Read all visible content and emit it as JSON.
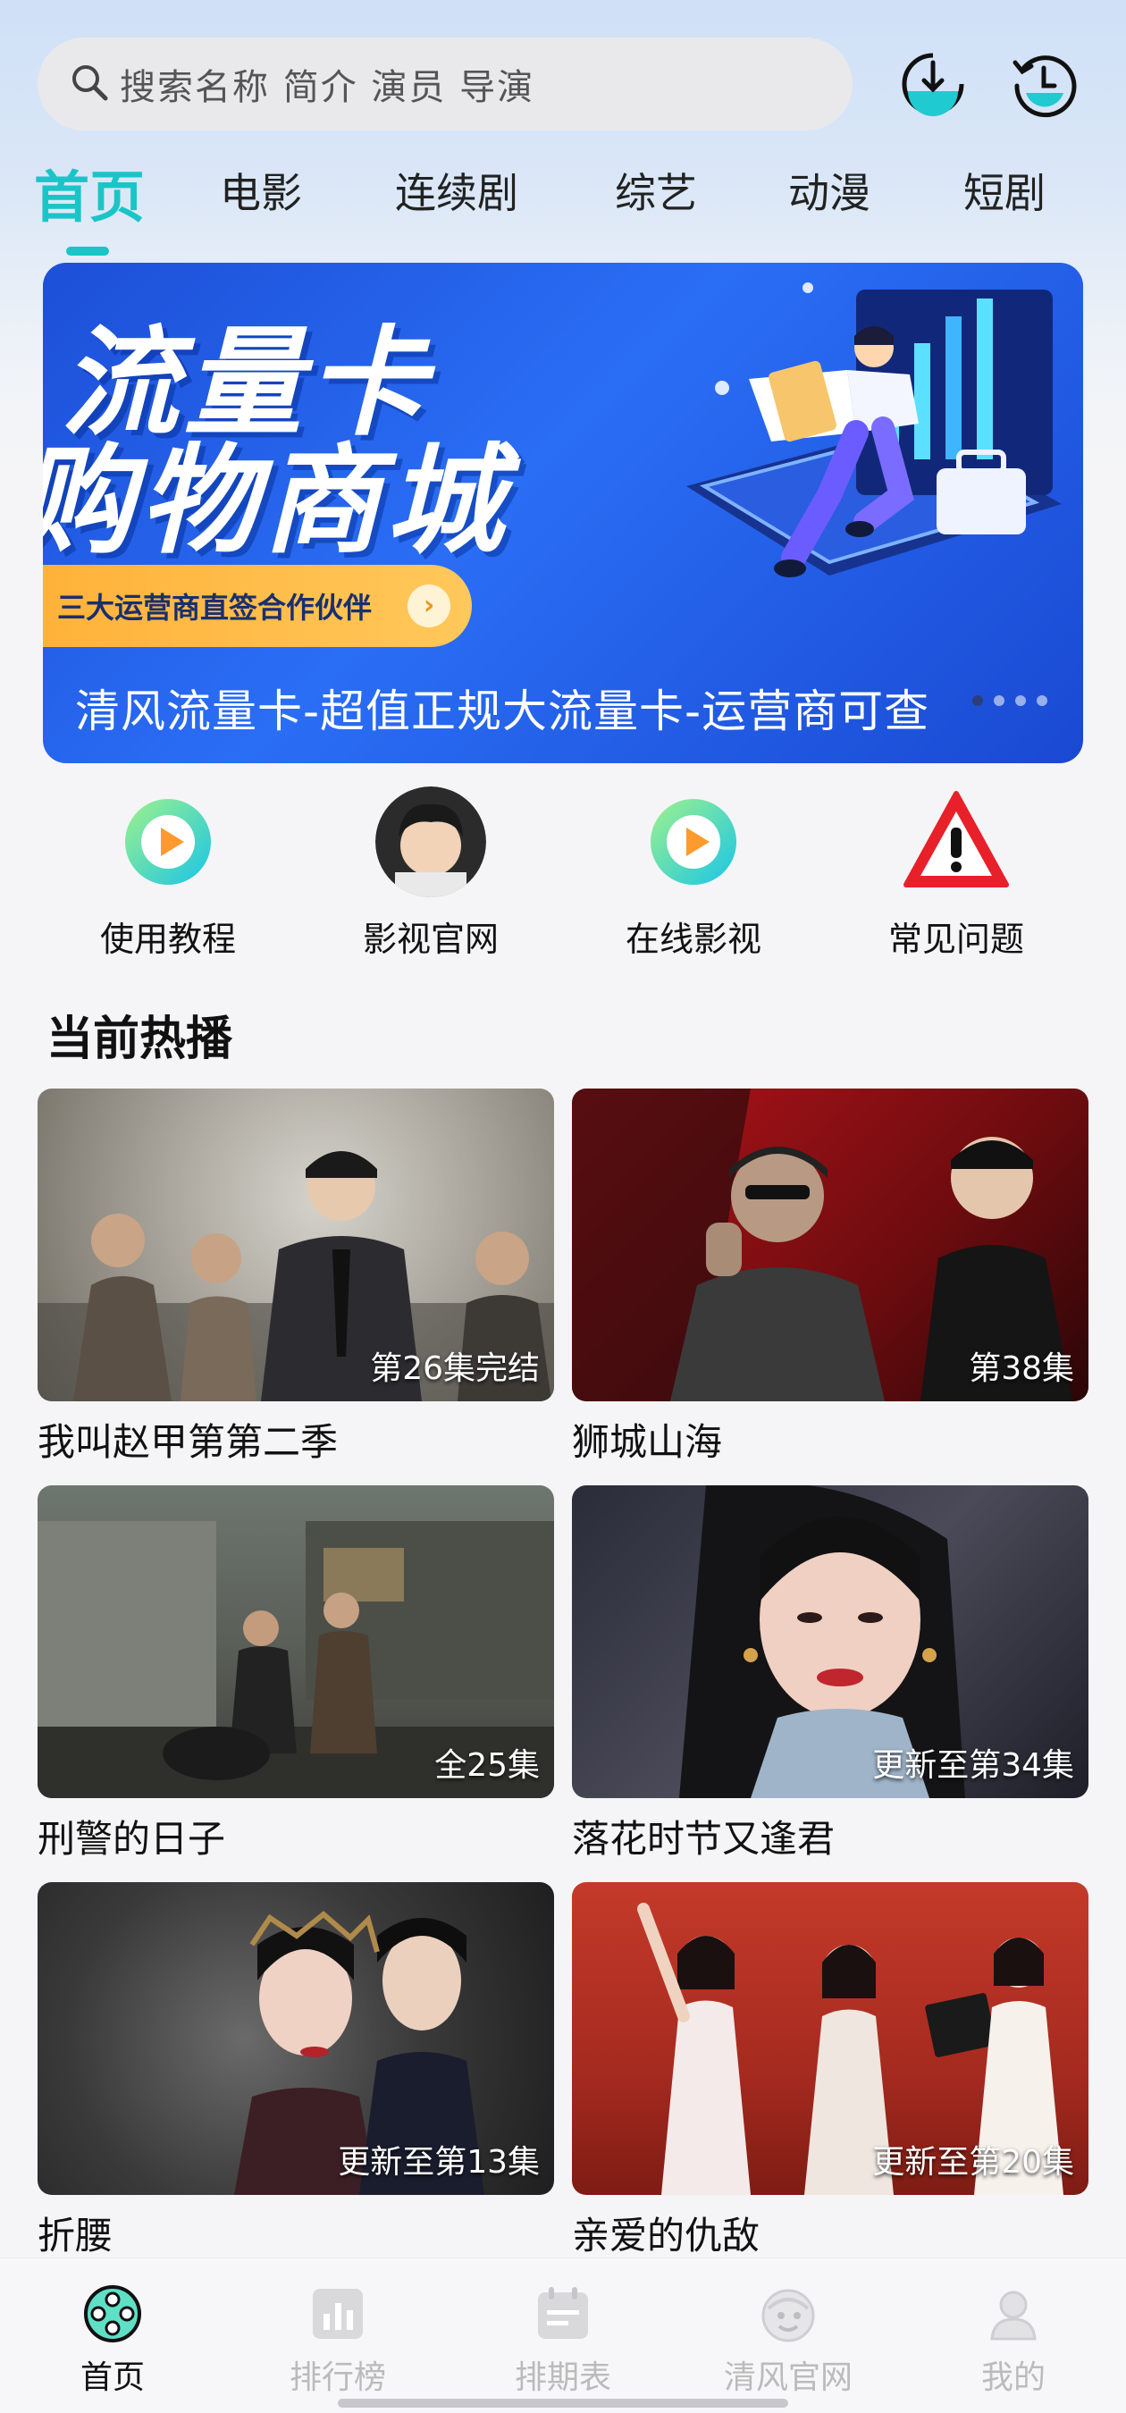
{
  "search": {
    "placeholder": "搜索名称 简介 演员 导演",
    "icon": "search-icon"
  },
  "header_icons": [
    {
      "name": "download-icon"
    },
    {
      "name": "history-icon"
    }
  ],
  "tabs": [
    {
      "label": "首页",
      "active": true
    },
    {
      "label": "电影"
    },
    {
      "label": "连续剧"
    },
    {
      "label": "综艺"
    },
    {
      "label": "动漫"
    },
    {
      "label": "短剧"
    }
  ],
  "banner": {
    "headline_1": "流量卡",
    "headline_2": "购物商城",
    "pill_text": "三大运营商直签合作伙伴",
    "pill_arrow": "›",
    "caption": "清风流量卡-超值正规大流量卡-运营商可查",
    "page_count": 4,
    "current_page": 1
  },
  "quick_links": [
    {
      "label": "使用教程",
      "icon": "play-icon"
    },
    {
      "label": "影视官网",
      "icon": "avatar"
    },
    {
      "label": "在线影视",
      "icon": "play-icon"
    },
    {
      "label": "常见问题",
      "icon": "warning-icon"
    }
  ],
  "section": {
    "title": "当前热播"
  },
  "shows": [
    {
      "title": "我叫赵甲第第二季",
      "episode": "第26集完结"
    },
    {
      "title": "狮城山海",
      "episode": "第38集"
    },
    {
      "title": "刑警的日子",
      "episode": "全25集"
    },
    {
      "title": "落花时节又逢君",
      "episode": "更新至第34集"
    },
    {
      "title": "折腰",
      "episode": "更新至第13集"
    },
    {
      "title": "亲爱的仇敌",
      "episode": "更新至第20集"
    }
  ],
  "bottom_nav": [
    {
      "label": "首页",
      "icon": "home-film-icon",
      "active": true
    },
    {
      "label": "排行榜",
      "icon": "chart-icon"
    },
    {
      "label": "排期表",
      "icon": "calendar-icon"
    },
    {
      "label": "清风官网",
      "icon": "globe-icon"
    },
    {
      "label": "我的",
      "icon": "profile-icon"
    }
  ],
  "colors": {
    "accent": "#19c5c7",
    "banner": "#2a6ef5",
    "pill": "#ffb23a"
  }
}
